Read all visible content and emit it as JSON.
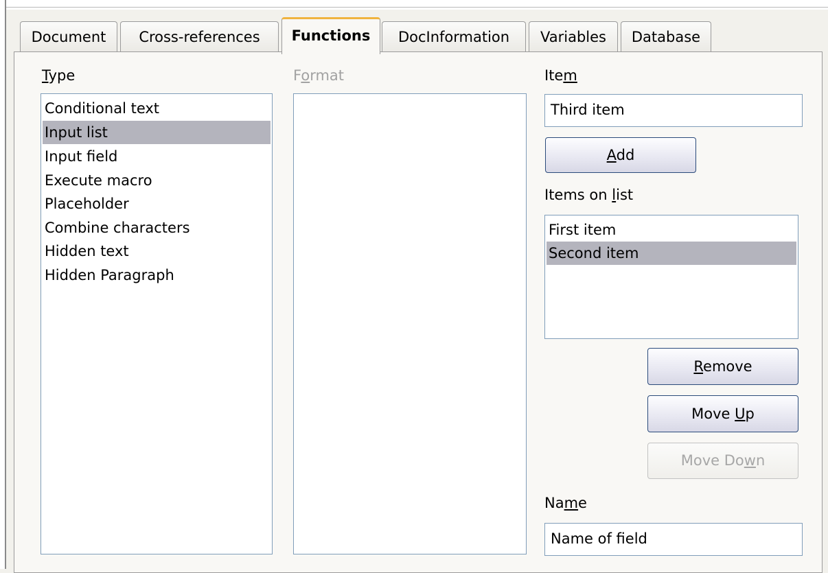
{
  "tabs": [
    {
      "label": "Document"
    },
    {
      "label": "Cross-references"
    },
    {
      "label": "Functions",
      "active": true
    },
    {
      "label": "DocInformation"
    },
    {
      "label": "Variables"
    },
    {
      "label": "Database"
    }
  ],
  "type": {
    "label_first": "T",
    "label_rest": "ype",
    "items": [
      {
        "label": "Conditional text"
      },
      {
        "label": "Input list",
        "selected": true
      },
      {
        "label": "Input field"
      },
      {
        "label": "Execute macro"
      },
      {
        "label": "Placeholder"
      },
      {
        "label": "Combine characters"
      },
      {
        "label": "Hidden text"
      },
      {
        "label": "Hidden Paragraph"
      }
    ]
  },
  "format": {
    "label_pre": "F",
    "label_u": "o",
    "label_post": "rmat",
    "items": []
  },
  "item": {
    "label_pre": "Ite",
    "label_u": "m",
    "value": "Third item"
  },
  "add_button": {
    "u": "A",
    "rest": "dd"
  },
  "items_on_list": {
    "label_pre": "Items on ",
    "label_u": "l",
    "label_post": "ist",
    "items": [
      {
        "label": "First item"
      },
      {
        "label": "Second item",
        "selected": true
      }
    ]
  },
  "remove_button": {
    "u": "R",
    "rest": "emove"
  },
  "move_up_button": {
    "pre": "Move ",
    "u": "U",
    "post": "p"
  },
  "move_down_button": {
    "pre": "Move Do",
    "u": "w",
    "post": "n",
    "disabled": true
  },
  "name": {
    "label_pre": "Na",
    "label_u": "m",
    "label_post": "e",
    "value": "Name of field"
  },
  "colors": {
    "selection": "#b4b4bd",
    "active_tab_accent": "#f0b33d",
    "list_border": "#7f9db9"
  }
}
